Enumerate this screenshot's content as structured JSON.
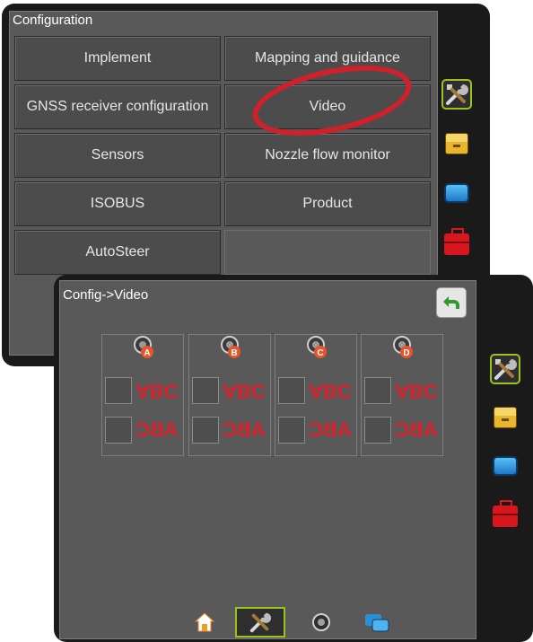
{
  "configuration": {
    "title": "Configuration",
    "buttons": [
      {
        "label": "Implement"
      },
      {
        "label": "Mapping and guidance"
      },
      {
        "label": "GNSS receiver configuration"
      },
      {
        "label": "Video"
      },
      {
        "label": "Sensors"
      },
      {
        "label": "Nozzle flow monitor"
      },
      {
        "label": "ISOBUS"
      },
      {
        "label": "Product"
      },
      {
        "label": "AutoSteer"
      }
    ]
  },
  "side_tabs": [
    {
      "icon": "tools-icon",
      "active": true
    },
    {
      "icon": "file-box-icon",
      "active": false
    },
    {
      "icon": "screen-icon",
      "active": false
    },
    {
      "icon": "toolbox-icon",
      "active": false
    }
  ],
  "video_config": {
    "title": "Config->Video",
    "cameras": [
      {
        "label": "A",
        "text_flip_vertical": "ABC",
        "text_flip_horizontal": "ABC"
      },
      {
        "label": "B",
        "text_flip_vertical": "ABC",
        "text_flip_horizontal": "ABC"
      },
      {
        "label": "C",
        "text_flip_vertical": "ABC",
        "text_flip_horizontal": "ABC"
      },
      {
        "label": "D",
        "text_flip_vertical": "ABC",
        "text_flip_horizontal": "ABC"
      }
    ]
  },
  "bottom_bar": [
    {
      "icon": "home-icon",
      "active": false
    },
    {
      "icon": "tools-icon",
      "active": true
    },
    {
      "icon": "camera-icon",
      "active": false
    },
    {
      "icon": "screens-icon",
      "active": false
    }
  ],
  "colors": {
    "highlight_circle": "#d0202a",
    "active_border": "#9ac31c",
    "camera_text": "#d7202a",
    "camera_badge": "#e8552b"
  }
}
